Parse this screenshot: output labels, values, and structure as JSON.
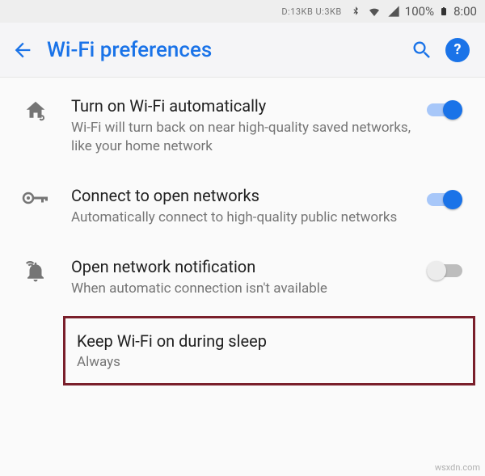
{
  "status": {
    "net": "D:13KB  U:3KB",
    "battery_pct": "100%",
    "clock": "8:00"
  },
  "appbar": {
    "title": "Wi-Fi preferences"
  },
  "rows": [
    {
      "title": "Turn on Wi-Fi automatically",
      "sub": "Wi-Fi will turn back on near high-quality saved networks, like your home network",
      "toggle": "on"
    },
    {
      "title": "Connect to open networks",
      "sub": "Automatically connect to high-quality public networks",
      "toggle": "on"
    },
    {
      "title": "Open network notification",
      "sub": "When automatic connection isn't available",
      "toggle": "off"
    }
  ],
  "highlight": {
    "title": "Keep Wi-Fi on during sleep",
    "sub": "Always"
  },
  "watermark": "wsxdn.com"
}
